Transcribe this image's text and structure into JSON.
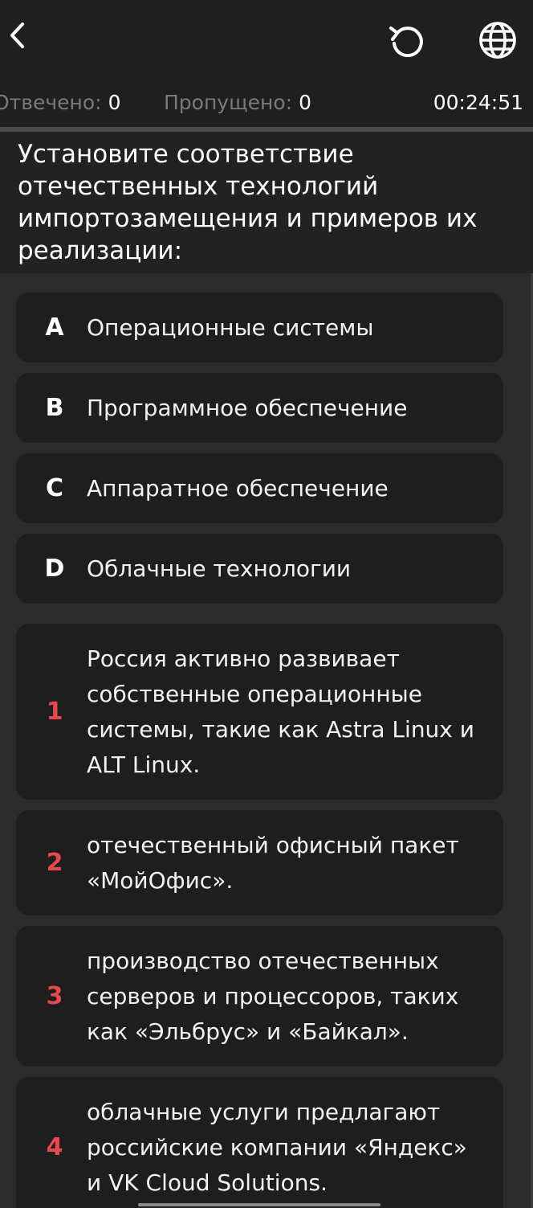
{
  "header": {
    "back_icon": "chevron-left-icon",
    "restart_icon": "restart-icon",
    "language_icon": "globe-icon"
  },
  "stats": {
    "answered_label": "Отвечено:",
    "answered_value": "0",
    "skipped_label": "Пропущено:",
    "skipped_value": "0",
    "timer": "00:24:51"
  },
  "question": {
    "text": "Установите соответствие отечественных технологий импортозамещения и примеров их реализации:"
  },
  "categories": [
    {
      "key": "A",
      "label": "Операционные системы"
    },
    {
      "key": "B",
      "label": "Программное обеспечение"
    },
    {
      "key": "C",
      "label": "Аппаратное обеспечение"
    },
    {
      "key": "D",
      "label": "Облачные технологии"
    }
  ],
  "examples": [
    {
      "key": "1",
      "text": "Россия активно развивает собственные операционные системы, такие как Astra Linux и ALT Linux."
    },
    {
      "key": "2",
      "text": "отечественный офисный пакет «МойОфис»."
    },
    {
      "key": "3",
      "text": "производство отечественных серверов и процессоров, таких как «Эльбрус» и «Байкал»."
    },
    {
      "key": "4",
      "text": "облачные услуги предлагают российские компании «Яндекс» и VK Cloud Solutions."
    }
  ],
  "colors": {
    "background": "#2b2b2b",
    "header": "#1f1f1f",
    "card": "#1e1e1e",
    "accent_red": "#e5484d",
    "muted_text": "#7a7a7a"
  }
}
